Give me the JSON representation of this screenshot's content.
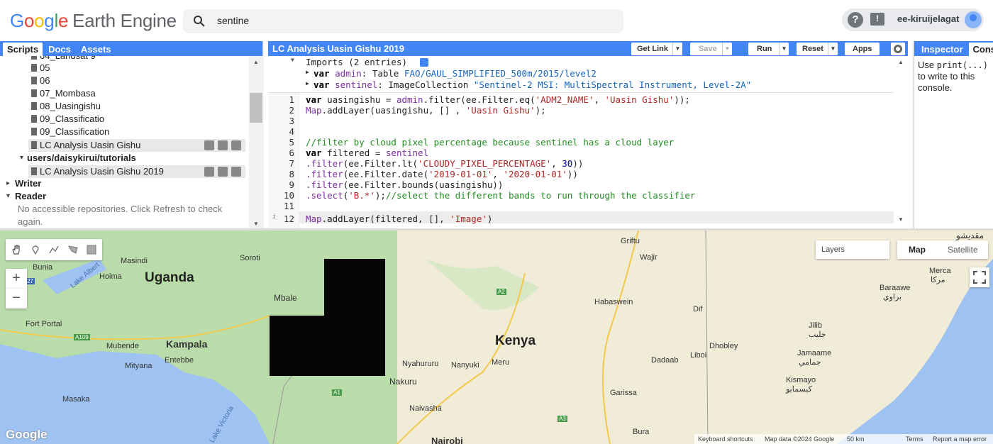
{
  "app": {
    "logo_letters": [
      "G",
      "o",
      "o",
      "g",
      "l",
      "e"
    ],
    "logo_suffix": "Earth Engine",
    "search_value": "sentine",
    "username": "ee-kiruijelagat",
    "help_glyph": "?",
    "feedback_glyph": "!"
  },
  "left_panel": {
    "tabs": [
      "Scripts",
      "Docs",
      "Assets"
    ],
    "active_tab": "Scripts",
    "tree": {
      "cut_item": "04_Landsat 9",
      "files": [
        "05",
        "06",
        "07_Mombasa",
        "08_Uasingishu",
        "09_Classificatio",
        "09_Classification",
        "LC Analysis Uasin Gishu"
      ],
      "repo2": "users/daisykirui/tutorials",
      "repo2_files": [
        "LC Analysis Uasin Gishu 2019"
      ],
      "writer": "Writer",
      "reader": "Reader",
      "reader_note": "No accessible repositories. Click Refresh to check",
      "reader_note2": "again."
    }
  },
  "editor": {
    "title": "LC Analysis Uasin Gishu 2019",
    "buttons": {
      "get_link": "Get Link",
      "save": "Save",
      "run": "Run",
      "reset": "Reset",
      "apps": "Apps"
    },
    "imports_header": "Imports (2 entries)",
    "imports": [
      {
        "name": "admin",
        "type": "Table",
        "value": "FAO/GAUL_SIMPLIFIED_500m/2015/level2"
      },
      {
        "name": "sentinel",
        "type": "ImageCollection",
        "value": "\"Sentinel-2 MSI: MultiSpectral Instrument, Level-2A\""
      }
    ],
    "line_numbers": [
      "1",
      "2",
      "3",
      "4",
      "5",
      "6",
      "7",
      "8",
      "9",
      "10",
      "11",
      "12"
    ],
    "lines": [
      [
        [
          "kw",
          "var"
        ],
        [
          "",
          "uasingishu = "
        ],
        [
          "vr",
          "admin"
        ],
        [
          "",
          ".filter(ee.Filter.eq("
        ],
        [
          "str",
          "'ADM2_NAME'"
        ],
        [
          "",
          ", "
        ],
        [
          "str",
          "'Uasin Gishu'"
        ],
        [
          "",
          "));"
        ]
      ],
      [
        [
          "vr",
          "Map"
        ],
        [
          "",
          ".addLayer(uasingishu, [] , "
        ],
        [
          "str",
          "'Uasin Gishu'"
        ],
        [
          "",
          ");"
        ]
      ],
      [],
      [],
      [
        [
          "cm",
          "//filter by cloud pixel percentage because sentinel has a cloud layer"
        ]
      ],
      [
        [
          "kw",
          "var"
        ],
        [
          "",
          "filtered = "
        ],
        [
          "vr",
          "sentinel"
        ]
      ],
      [
        [
          "vr",
          ".filter"
        ],
        [
          "",
          "(ee.Filter.lt("
        ],
        [
          "str",
          "'CLOUDY_PIXEL_PERCENTAGE'"
        ],
        [
          "",
          ", "
        ],
        [
          "num",
          "30"
        ],
        [
          "",
          "))"
        ]
      ],
      [
        [
          "vr",
          ".filter"
        ],
        [
          "",
          "(ee.Filter.date("
        ],
        [
          "str",
          "'2019-01-01'"
        ],
        [
          "",
          ", "
        ],
        [
          "str",
          "'2020-01-01'"
        ],
        [
          "",
          "))"
        ]
      ],
      [
        [
          "vr",
          ".filter"
        ],
        [
          "",
          "(ee.Filter.bounds(uasingishu))"
        ]
      ],
      [
        [
          "vr",
          ".select"
        ],
        [
          "",
          "("
        ],
        [
          "str",
          "'B.*'"
        ],
        [
          "",
          ");"
        ],
        [
          "cm",
          "//select the different bands to run through the classifier"
        ]
      ],
      [],
      [
        [
          "vr",
          "Map"
        ],
        [
          "",
          ".addLayer(filtered, [], "
        ],
        [
          "str",
          "'Image'"
        ],
        [
          "",
          ")"
        ]
      ]
    ]
  },
  "right_panel": {
    "tabs": [
      "Inspector",
      "Cons"
    ],
    "console_pre": "Use ",
    "console_code": "print(...)",
    "console_post": "to write to this console."
  },
  "map": {
    "layers_label": "Layers",
    "map_type_map": "Map",
    "map_type_satellite": "Satellite",
    "zoom_in": "+",
    "zoom_out": "−",
    "google": "Google",
    "footer": {
      "shortcuts": "Keyboard shortcuts",
      "data": "Map data ©2024 Google",
      "scale": "50 km",
      "terms": "Terms",
      "report": "Report a map error"
    },
    "labels": {
      "uganda": "Uganda",
      "kenya": "Kenya",
      "kampala": "Kampala",
      "masindi": "Masindi",
      "soroti": "Soroti",
      "bunia": "Bunia",
      "hoima": "Hoima",
      "lake_albert": "Lake Albert",
      "mbale": "Mbale",
      "fort_portal": "Fort Portal",
      "mubende": "Mubende",
      "mityana": "Mityana",
      "entebbe": "Entebbe",
      "masaka": "Masaka",
      "griftu": "Griftu",
      "wajir": "Wajir",
      "habaswein": "Habaswein",
      "dif": "Dif",
      "nyahururu": "Nyahururu",
      "nanyuki": "Nanyuki",
      "meru": "Meru",
      "nakuru": "Nakuru",
      "naivasha": "Naivasha",
      "nairobi": "Nairobi",
      "garissa": "Garissa",
      "dadaab": "Dadaab",
      "liboi": "Liboi",
      "dhobley": "Dhobley",
      "bura": "Bura",
      "merca": "Merca",
      "merca_ar": "مركا",
      "baraawe": "Baraawe",
      "baraawe_ar": "براوي",
      "jilib": "Jilib",
      "jilib_ar": "جليب",
      "jamaame": "Jamaame",
      "jamaame_ar": "جمامي",
      "kismayo": "Kismayo",
      "kismayo_ar": "كيسمايو",
      "top_ar": "مقديشو",
      "victoria": "Lake Victoria",
      "a2": "A2",
      "a1": "A1",
      "a3": "A3",
      "a109": "A109",
      "a27": "27"
    }
  }
}
